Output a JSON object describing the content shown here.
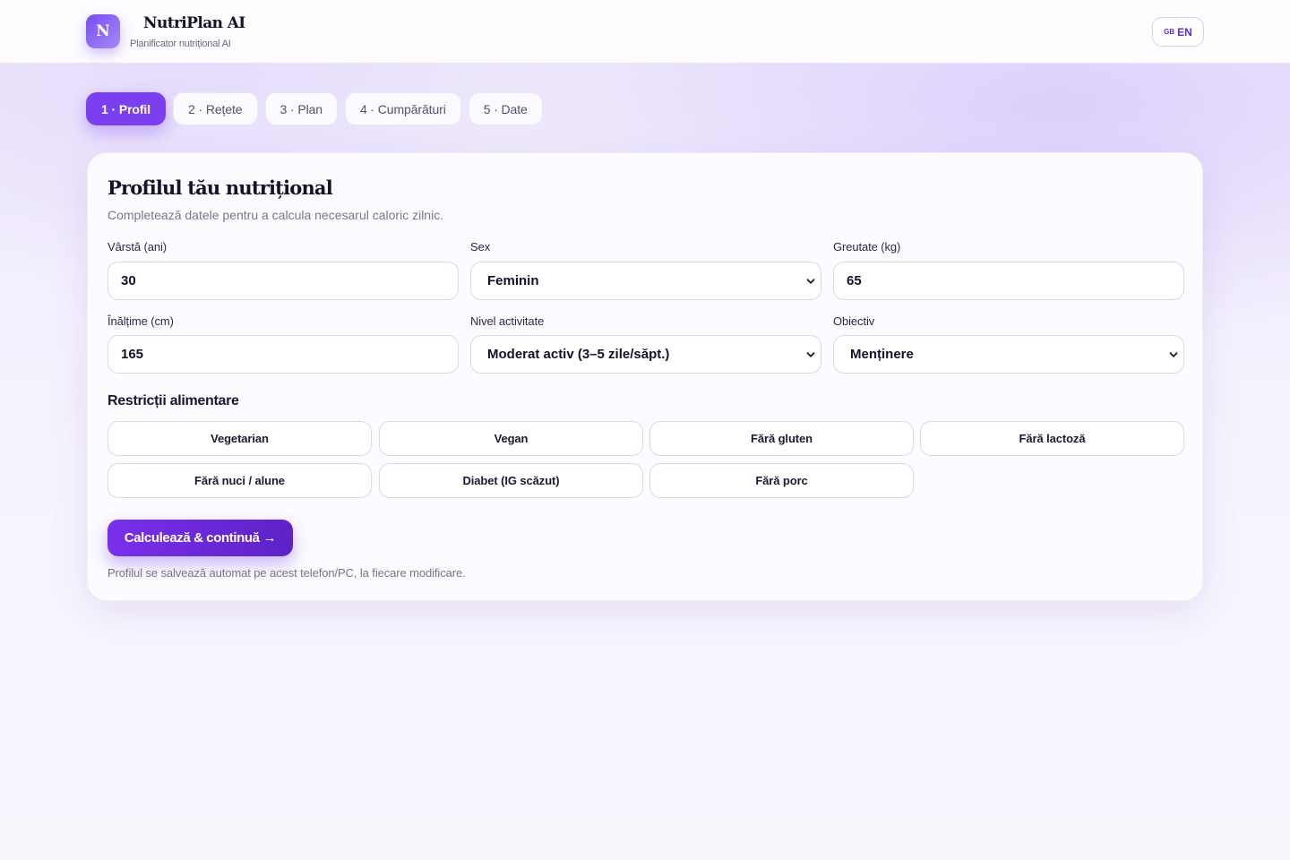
{
  "app": {
    "logo_letter": "N",
    "title": "NutriPlan AI",
    "subtitle": "Planificator nutrițional AI",
    "lang_flag": "GB",
    "lang_label": "EN"
  },
  "tabs": [
    {
      "label": "1 · Profil",
      "active": true
    },
    {
      "label": "2 · Rețete",
      "active": false
    },
    {
      "label": "3 · Plan",
      "active": false
    },
    {
      "label": "4 · Cumpărături",
      "active": false
    },
    {
      "label": "5 · Date",
      "active": false
    }
  ],
  "profile": {
    "title": "Profilul tău nutrițional",
    "subtitle": "Completează datele pentru a calcula necesarul caloric zilnic.",
    "fields": {
      "age": {
        "label": "Vârstă (ani)",
        "value": "30"
      },
      "sex": {
        "label": "Sex",
        "value": "Feminin"
      },
      "weight": {
        "label": "Greutate (kg)",
        "value": "65"
      },
      "height": {
        "label": "Înălțime (cm)",
        "value": "165"
      },
      "activity": {
        "label": "Nivel activitate",
        "value": "Moderat activ (3–5 zile/săpt.)"
      },
      "goal": {
        "label": "Obiectiv",
        "value": "Menținere"
      }
    },
    "restrictions_title": "Restricții alimentare",
    "restrictions": [
      "Vegetarian",
      "Vegan",
      "Fără gluten",
      "Fără lactoză",
      "Fără nuci / alune",
      "Diabet (IG scăzut)",
      "Fără porc"
    ],
    "cta_label": "Calculează & continuă",
    "cta_arrow": "→",
    "note": "Profilul se salvează automat pe acest telefon/PC, la fiecare modificare."
  },
  "colors": {
    "accent": "#7b3ff0",
    "accent_dark": "#5d22c7"
  }
}
